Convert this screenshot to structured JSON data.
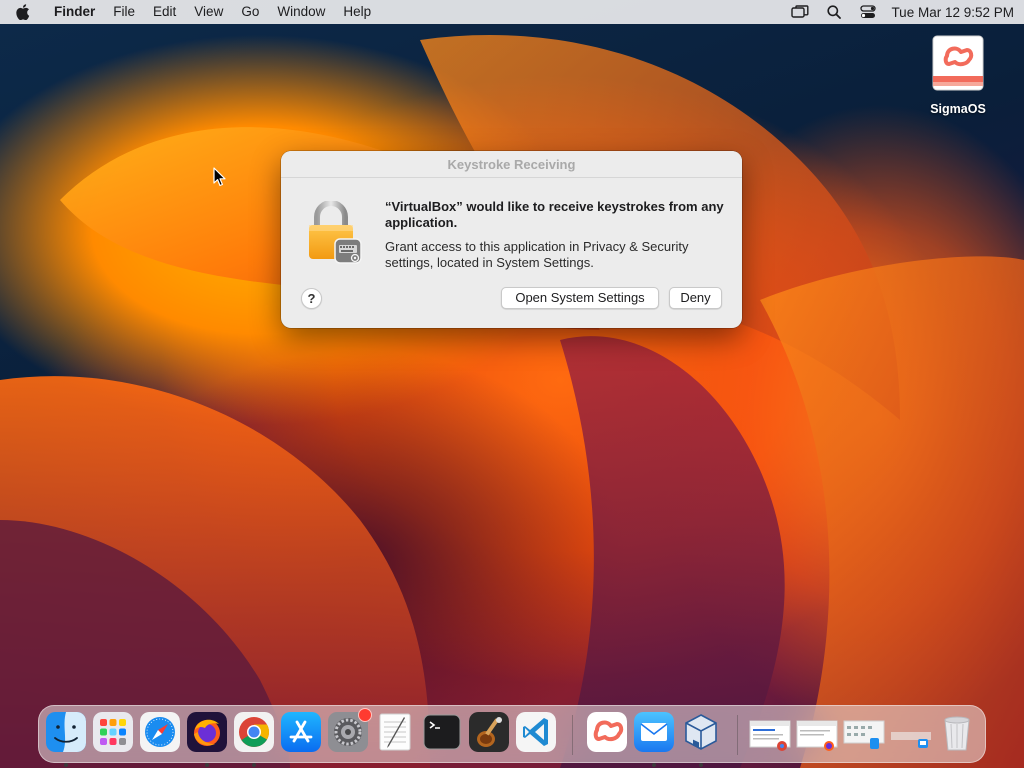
{
  "menubar": {
    "apple_icon": "apple-logo-icon",
    "app_name": "Finder",
    "items": [
      "File",
      "Edit",
      "View",
      "Go",
      "Window",
      "Help"
    ],
    "status_icons": [
      "screen-mirroring-icon",
      "spotlight-search-icon",
      "control-center-icon"
    ],
    "clock": "Tue Mar 12  9:52 PM"
  },
  "desktop": {
    "icon_label": "SigmaOS",
    "icon_name": "sigmaos-app-icon"
  },
  "dialog": {
    "title": "Keystroke Receiving",
    "headline": "“VirtualBox” would like to receive keystrokes from any application.",
    "body": "Grant access to this application in Privacy & Security settings, located in System Settings.",
    "help_label": "?",
    "primary_button": "Open System Settings",
    "secondary_button": "Deny",
    "icon": "lock-keyboard-icon"
  },
  "dock": {
    "apps": [
      {
        "name": "Finder",
        "icon": "finder-icon",
        "running": true
      },
      {
        "name": "Launchpad",
        "icon": "launchpad-icon",
        "running": false
      },
      {
        "name": "Safari",
        "icon": "safari-icon",
        "running": false
      },
      {
        "name": "Firefox",
        "icon": "firefox-icon",
        "running": true
      },
      {
        "name": "Google Chrome",
        "icon": "chrome-icon",
        "running": true
      },
      {
        "name": "App Store",
        "icon": "app-store-icon",
        "running": false
      },
      {
        "name": "System Settings",
        "icon": "system-settings-icon",
        "running": false,
        "badge": true
      },
      {
        "name": "TextEdit",
        "icon": "textedit-icon",
        "running": false
      },
      {
        "name": "Terminal",
        "icon": "terminal-icon",
        "running": false
      },
      {
        "name": "Instruments",
        "icon": "instruments-icon",
        "running": false
      },
      {
        "name": "Visual Studio Code",
        "icon": "vscode-icon",
        "running": false
      },
      {
        "name": "SigmaOS",
        "icon": "sigmaos-icon",
        "running": false
      },
      {
        "name": "Mail",
        "icon": "mail-icon",
        "running": true
      },
      {
        "name": "VirtualBox",
        "icon": "virtualbox-icon",
        "running": true
      }
    ],
    "minimized": [
      {
        "name": "Chrome window",
        "icon": "minimized-chrome-window-icon"
      },
      {
        "name": "Firefox window",
        "icon": "minimized-firefox-window-icon"
      },
      {
        "name": "Finder window",
        "icon": "minimized-finder-window-icon"
      },
      {
        "name": "Window",
        "icon": "minimized-window-icon"
      }
    ],
    "trash": {
      "name": "Trash",
      "icon": "trash-icon"
    }
  },
  "colors": {
    "accent": "#0a84ff",
    "dialog_bg": "#ececec",
    "badge": "#ff3b30"
  }
}
